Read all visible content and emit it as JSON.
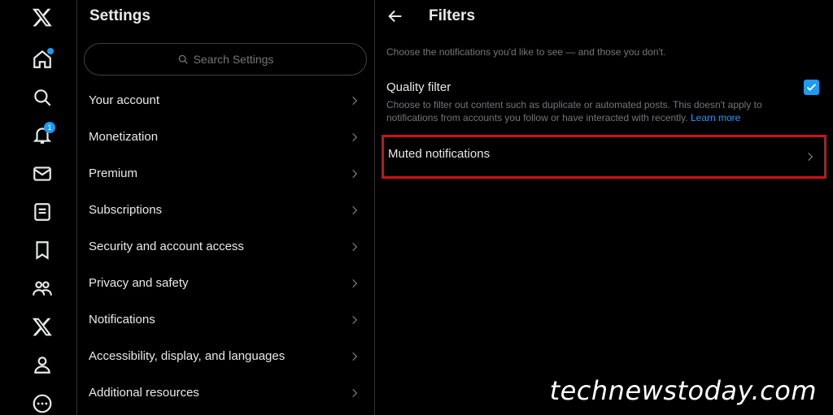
{
  "rail": {
    "icons": [
      "x-logo-icon",
      "home-icon",
      "search-icon",
      "notifications-icon",
      "messages-icon",
      "lists-icon",
      "bookmarks-icon",
      "communities-icon",
      "premium-x-icon",
      "profile-icon",
      "more-icon"
    ],
    "notifications_badge": "1"
  },
  "settings": {
    "title": "Settings",
    "search_placeholder": "Search Settings",
    "items": [
      {
        "label": "Your account"
      },
      {
        "label": "Monetization"
      },
      {
        "label": "Premium"
      },
      {
        "label": "Subscriptions"
      },
      {
        "label": "Security and account access"
      },
      {
        "label": "Privacy and safety"
      },
      {
        "label": "Notifications"
      },
      {
        "label": "Accessibility, display, and languages"
      },
      {
        "label": "Additional resources"
      }
    ]
  },
  "filters": {
    "title": "Filters",
    "intro": "Choose the notifications you'd like to see — and those you don't.",
    "quality_filter": {
      "label": "Quality filter",
      "description": "Choose to filter out content such as duplicate or automated posts. This doesn't apply to notifications from accounts you follow or have interacted with recently.",
      "link": "Learn more",
      "checked": true
    },
    "muted_notifications": "Muted notifications"
  },
  "colors": {
    "accent": "#1d9bf0",
    "highlight": "#d10f1a",
    "background": "#000000"
  },
  "watermark": "technewstoday.com"
}
